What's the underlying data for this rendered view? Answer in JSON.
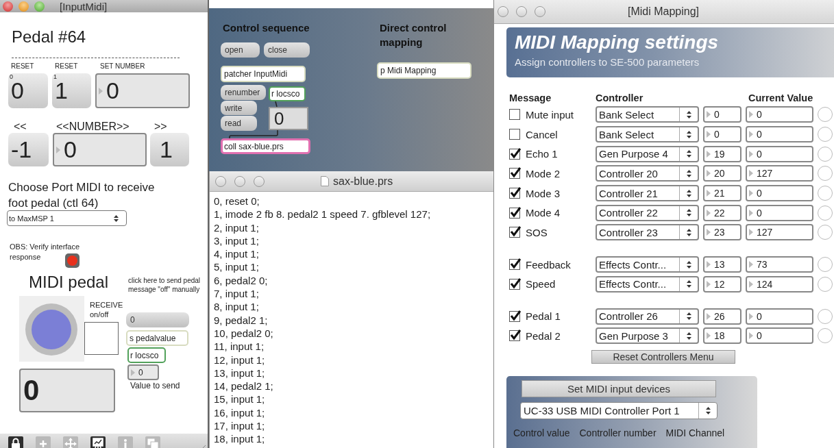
{
  "input_midi": {
    "title": "[InputMidi]",
    "heading": "Pedal #64",
    "reset_labels": [
      "RESET",
      "RESET",
      "SET NUMBER"
    ],
    "reset_buttons": [
      {
        "label": "0",
        "corner": "0"
      },
      {
        "label": "1",
        "corner": "1"
      }
    ],
    "set_number": "0",
    "stepper_labels": [
      "<<",
      "<<NUMBER>>",
      ">>"
    ],
    "stepper": {
      "minus": "-1",
      "number": "0",
      "plus": "1"
    },
    "port_label": "Choose Port MIDI to receive foot pedal (ctl 64)",
    "port_menu": "to MaxMSP 1",
    "obs_label": "OBS: Verify interface response",
    "obs_led_on": true,
    "pedal_title": "MIDI pedal",
    "receive_label": "RECEIVE on/off",
    "receive_checked": false,
    "send_hint": "click here to send pedal message \"off\" manually",
    "send_message": "0",
    "send_object": "s pedalvalue",
    "receive_object": "r locsco",
    "send_number": "0",
    "send_label": "Value to send",
    "pedal_value": "0",
    "toolbar": [
      {
        "kind": "lock",
        "on": true
      },
      {
        "kind": "add",
        "on": false
      },
      {
        "kind": "move",
        "on": false
      },
      {
        "kind": "presentation",
        "on": true
      },
      {
        "kind": "info",
        "on": false
      },
      {
        "kind": "window",
        "on": false
      }
    ]
  },
  "control": {
    "sequence_title": "Control sequence",
    "mapping_title": "Direct control mapping",
    "objects": [
      {
        "kind": "message",
        "text": "open"
      },
      {
        "kind": "message",
        "text": "close"
      },
      {
        "kind": "object",
        "text": "patcher InputMidi"
      },
      {
        "kind": "message",
        "text": "renumber"
      },
      {
        "kind": "receive",
        "text": "r locsco"
      },
      {
        "kind": "message",
        "text": "write"
      },
      {
        "kind": "message",
        "text": "read"
      },
      {
        "kind": "number",
        "text": "0"
      },
      {
        "kind": "coll",
        "text": "coll sax-blue.prs"
      },
      {
        "kind": "object",
        "text": "p Midi Mapping"
      }
    ]
  },
  "text_window": {
    "title": "sax-blue.prs",
    "lines": [
      "0, reset 0;",
      "1, imode 2 fb 8. pedal2 1 speed 7. gfblevel 127;",
      "2, input 1;",
      "3, input 1;",
      "4, input 1;",
      "5, input 1;",
      "6, pedal2 0;",
      "7, input 1;",
      "8, input 1;",
      "9, pedal2 1;",
      "10, pedal2 0;",
      "11, input 1;",
      "12, input 1;",
      "13, input 1;",
      "14, pedal2 1;",
      "15, input 1;",
      "16, input 1;",
      "17, input 1;",
      "18, input 1;"
    ]
  },
  "midi_mapping": {
    "title": "[Midi Mapping]",
    "banner_title": "MIDI Mapping settings",
    "banner_subtitle": "Assign controllers to SE-500 parameters",
    "headers": [
      "Message",
      "Controller",
      "Current Value"
    ],
    "groups": [
      {
        "rows": [
          {
            "checked": false,
            "label": "Mute input",
            "controller": "Bank Select",
            "number": "0",
            "value": "0"
          },
          {
            "checked": false,
            "label": "Cancel",
            "controller": "Bank Select",
            "number": "0",
            "value": "0"
          },
          {
            "checked": true,
            "label": "Echo 1",
            "controller": "Gen Purpose 4",
            "number": "19",
            "value": "0"
          },
          {
            "checked": true,
            "label": "Mode 2",
            "controller": "Controller 20",
            "number": "20",
            "value": "127"
          },
          {
            "checked": true,
            "label": "Mode 3",
            "controller": "Controller 21",
            "number": "21",
            "value": "0"
          },
          {
            "checked": true,
            "label": "Mode 4",
            "controller": "Controller 22",
            "number": "22",
            "value": "0"
          },
          {
            "checked": true,
            "label": "SOS",
            "controller": "Controller 23",
            "number": "23",
            "value": "127"
          }
        ]
      },
      {
        "rows": [
          {
            "checked": true,
            "label": "Feedback",
            "controller": "Effects Contr...",
            "number": "13",
            "value": "73"
          },
          {
            "checked": true,
            "label": "Speed",
            "controller": "Effects Contr...",
            "number": "12",
            "value": "124"
          }
        ]
      },
      {
        "rows": [
          {
            "checked": true,
            "label": "Pedal 1",
            "controller": "Controller 26",
            "number": "26",
            "value": "0"
          },
          {
            "checked": true,
            "label": "Pedal 2",
            "controller": "Gen Purpose 3",
            "number": "18",
            "value": "0"
          }
        ]
      }
    ],
    "reset_button": "Reset Controllers Menu",
    "devices_button": "Set MIDI input devices",
    "device_menu": "UC-33 USB MIDI Controller Port 1",
    "footer_labels": [
      "Control value",
      "Controller number",
      "MIDI Channel"
    ]
  }
}
